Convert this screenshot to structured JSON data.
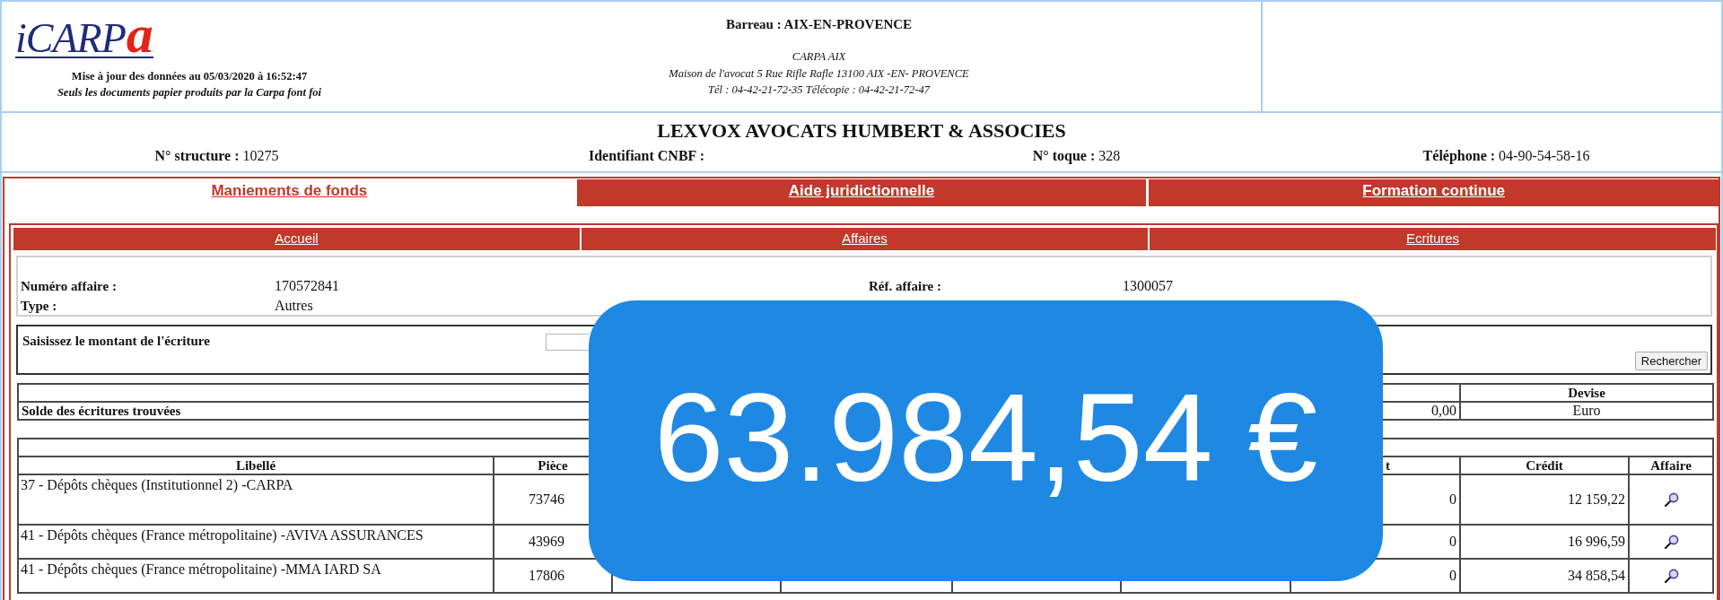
{
  "header": {
    "logo": {
      "text": "iCARP",
      "accent": "a"
    },
    "update_notice": "Mise à jour des données au 05/03/2020 à 16:52:47",
    "disclaimer": "Seuls les documents papier produits par la Carpa font foi",
    "barreau": "Barreau : AIX-EN-PROVENCE",
    "carpa_lines": [
      "CARPA AIX",
      "Maison de l'avocat 5 Rue Rifle Rafle 13100 AIX -EN- PROVENCE",
      "Tél : 04-42-21-72-35 Télécopie : 04-42-21-72-47"
    ]
  },
  "firm": {
    "name": "LEXVOX AVOCATS HUMBERT & ASSOCIES",
    "fields": [
      {
        "label": "N° structure :",
        "value": "10275"
      },
      {
        "label": "Identifiant CNBF :"
      },
      {
        "label": "N° toque :",
        "value": "328"
      },
      {
        "label": "Téléphone :",
        "value": "04-90-54-58-16"
      }
    ]
  },
  "tabs": [
    {
      "label": "Maniements de fonds",
      "selected": true
    },
    {
      "label": "Aide juridictionnelle",
      "selected": false
    },
    {
      "label": "Formation continue",
      "selected": false
    }
  ],
  "subtabs": [
    {
      "label": "Accueil"
    },
    {
      "label": "Affaires"
    },
    {
      "label": "Ecritures"
    }
  ],
  "affaire": {
    "rows": [
      [
        {
          "label": "Numéro affaire :",
          "value": "170572841"
        },
        {
          "label": "Réf. affaire :",
          "value": "1300057"
        }
      ],
      [
        {
          "label": "Type :",
          "value": "Autres"
        }
      ]
    ]
  },
  "search": {
    "label": "Saisissez le montant de l'écriture",
    "button": "Rechercher"
  },
  "balance": {
    "columns": {
      "devise": "Devise"
    },
    "row": {
      "label": "Solde des écritures trouvées",
      "amount": "0,00",
      "devise": "Euro"
    }
  },
  "entries": {
    "columns": {
      "libelle": "Libellé",
      "piece": "Pièce",
      "column_7": "t",
      "credit": "Crédit",
      "affaire": "Affaire"
    },
    "rows": [
      {
        "libelle": "37 - Dépôts chèques (Institutionnel 2) -CARPA",
        "piece": "73746",
        "column_7": "0",
        "credit": "12 159,22"
      },
      {
        "libelle": "41 - Dépôts chèques (France métropolitaine) -AVIVA ASSURANCES",
        "piece": "43969",
        "column_7": "0",
        "credit": "16 996,59"
      },
      {
        "libelle": "41 - Dépôts chèques (France métropolitaine) -MMA IARD SA",
        "piece": "17806",
        "column_7": "0",
        "credit": "34 858,54"
      }
    ]
  },
  "overlay": {
    "amount": "63.984,54 €"
  }
}
